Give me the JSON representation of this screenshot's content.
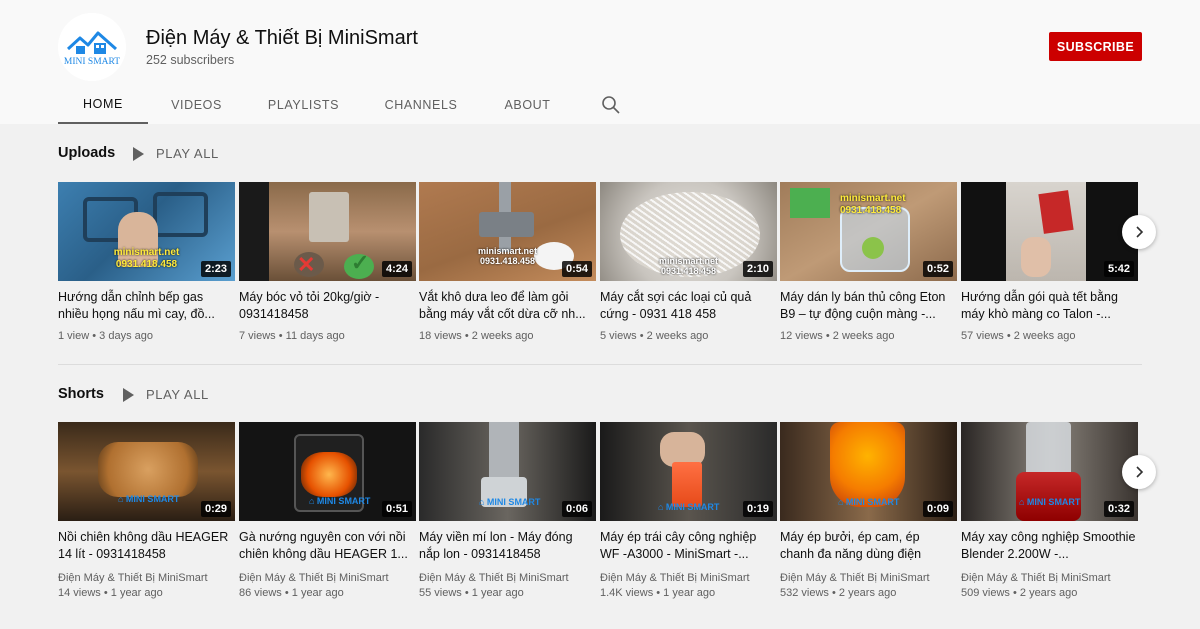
{
  "channel": {
    "name": "Điện Máy & Thiết Bị MiniSmart",
    "subscribers": "252 subscribers",
    "logo_text": "MINI SMART",
    "subscribe_label": "SUBSCRIBE"
  },
  "tabs": [
    {
      "label": "HOME",
      "active": true
    },
    {
      "label": "VIDEOS",
      "active": false
    },
    {
      "label": "PLAYLISTS",
      "active": false
    },
    {
      "label": "CHANNELS",
      "active": false
    },
    {
      "label": "ABOUT",
      "active": false
    }
  ],
  "uploads": {
    "title": "Uploads",
    "play_all": "PLAY ALL",
    "videos": [
      {
        "title": "Hướng dẫn chỉnh bếp gas nhiều họng nấu mì cay, đồ...",
        "duration": "2:23",
        "views": "1 view",
        "age": "3 days ago",
        "watermark": [
          "minismart.net",
          "0931.418.458"
        ]
      },
      {
        "title": "Máy bóc vỏ tỏi 20kg/giờ - 0931418458",
        "duration": "4:24",
        "views": "7 views",
        "age": "11 days ago"
      },
      {
        "title": "Vắt khô dưa leo để làm gỏi bằng máy vắt cốt dừa cỡ nh...",
        "duration": "0:54",
        "views": "18 views",
        "age": "2 weeks ago",
        "watermark": [
          "minismart.net",
          "0931.418.458"
        ]
      },
      {
        "title": "Máy cắt sợi các loại củ quả cứng - 0931 418 458",
        "duration": "2:10",
        "views": "5 views",
        "age": "2 weeks ago",
        "watermark": [
          "minismart.net",
          "0931.418.458"
        ]
      },
      {
        "title": "Máy dán ly bán thủ công Eton B9 – tự động cuộn màng -...",
        "duration": "0:52",
        "views": "12 views",
        "age": "2 weeks ago",
        "watermark": [
          "minismart.net",
          "0931.418.458"
        ]
      },
      {
        "title": "Hướng dẫn gói quà tết bằng máy khò màng co Talon -...",
        "duration": "5:42",
        "views": "57 views",
        "age": "2 weeks ago"
      }
    ]
  },
  "shorts": {
    "title": "Shorts",
    "play_all": "PLAY ALL",
    "videos": [
      {
        "title": "Nồi chiên không dầu HEAGER 14 lít - 0931418458",
        "duration": "0:29",
        "channel": "Điện Máy & Thiết Bị MiniSmart",
        "views": "14 views",
        "age": "1 year ago"
      },
      {
        "title": "Gà nướng nguyên con với nồi chiên không dầu HEAGER 1...",
        "duration": "0:51",
        "channel": "Điện Máy & Thiết Bị MiniSmart",
        "views": "86 views",
        "age": "1 year ago"
      },
      {
        "title": "Máy viền mí lon - Máy đóng nắp lon - 0931418458",
        "duration": "0:06",
        "channel": "Điện Máy & Thiết Bị MiniSmart",
        "views": "55 views",
        "age": "1 year ago"
      },
      {
        "title": "Máy ép trái cây công nghiệp WF -A3000 - MiniSmart -...",
        "duration": "0:19",
        "channel": "Điện Máy & Thiết Bị MiniSmart",
        "views": "1.4K views",
        "age": "1 year ago"
      },
      {
        "title": "Máy ép bưởi, ép cam, ép chanh đa năng dùng điện",
        "duration": "0:09",
        "channel": "Điện Máy & Thiết Bị MiniSmart",
        "views": "532 views",
        "age": "2 years ago"
      },
      {
        "title": "Máy xay công nghiệp Smoothie Blender 2.200W -...",
        "duration": "0:32",
        "channel": "Điện Máy & Thiết Bị MiniSmart",
        "views": "509 views",
        "age": "2 years ago"
      }
    ]
  },
  "colors": {
    "subscribe": "#cc0000",
    "background": "#f9f9f9",
    "content": "#f1f1f1",
    "secondary_text": "#606060"
  },
  "icons": {
    "search": "search-icon",
    "play": "play-icon",
    "next": "chevron-right-icon"
  }
}
